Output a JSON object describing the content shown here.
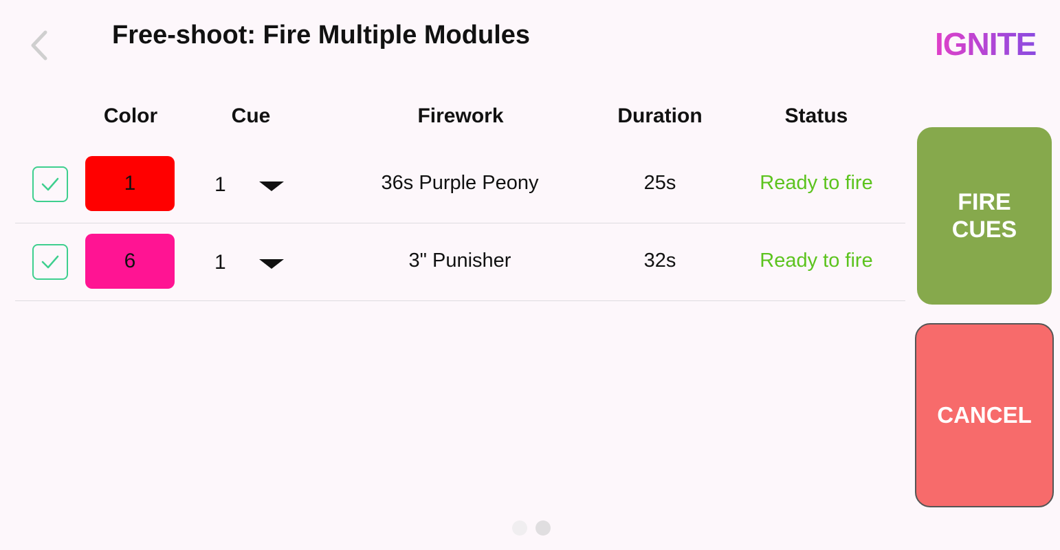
{
  "header": {
    "title": "Free-shoot: Fire Multiple Modules",
    "logo_text": "IGNITE"
  },
  "table": {
    "columns": [
      "Color",
      "Cue",
      "Firework",
      "Duration",
      "Status"
    ],
    "rows": [
      {
        "checked": true,
        "color_label": "1",
        "color_hex": "#ff0000",
        "cue": "1",
        "firework": "36s Purple Peony",
        "duration": "25s",
        "status": "Ready to fire"
      },
      {
        "checked": true,
        "color_label": "6",
        "color_hex": "#ff1493",
        "cue": "1",
        "firework": "3\" Punisher",
        "duration": "32s",
        "status": "Ready to fire"
      }
    ]
  },
  "actions": {
    "fire_label": "FIRE\nCUES",
    "cancel_label": "CANCEL"
  },
  "pager": {
    "pages": 2,
    "active_page": 2
  },
  "colors": {
    "background": "#fdf7fb",
    "fire_button": "#86a94c",
    "cancel_button": "#f76b6b",
    "status_ready": "#5cc31e",
    "checkbox": "#3ecf8e",
    "logo_gradient_start": "#e040c8",
    "logo_gradient_end": "#8a4be0",
    "dot_inactive": "#f0eef0",
    "dot_active": "#e0dee0",
    "back_chevron": "#cfcfcf"
  }
}
